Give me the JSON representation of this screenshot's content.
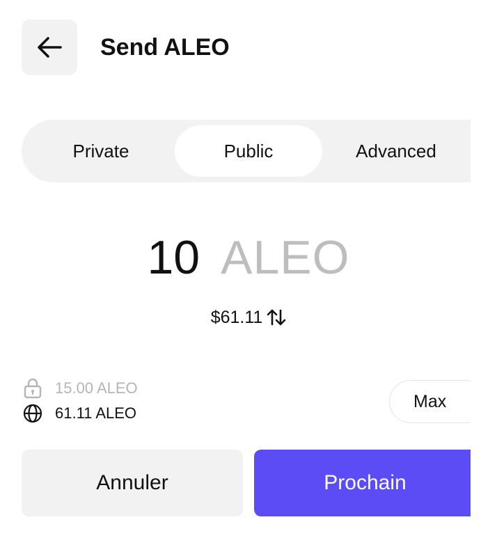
{
  "header": {
    "title": "Send ALEO"
  },
  "tabs": [
    {
      "label": "Private",
      "active": false
    },
    {
      "label": "Public",
      "active": true
    },
    {
      "label": "Advanced",
      "active": false
    }
  ],
  "amount": {
    "value": "10",
    "unit": "ALEO",
    "fiat": "$61.11"
  },
  "balances": {
    "private": "15.00 ALEO",
    "public": "61.11 ALEO"
  },
  "max_label": "Max",
  "actions": {
    "cancel_label": "Annuler",
    "next_label": "Prochain"
  },
  "icons": {
    "back": "arrow-left-icon",
    "swap": "swap-vertical-icon",
    "lock": "lock-icon",
    "globe": "globe-icon"
  },
  "colors": {
    "accent": "#5b4cf5",
    "surface": "#f2f2f2",
    "muted": "#bdbdbd"
  }
}
